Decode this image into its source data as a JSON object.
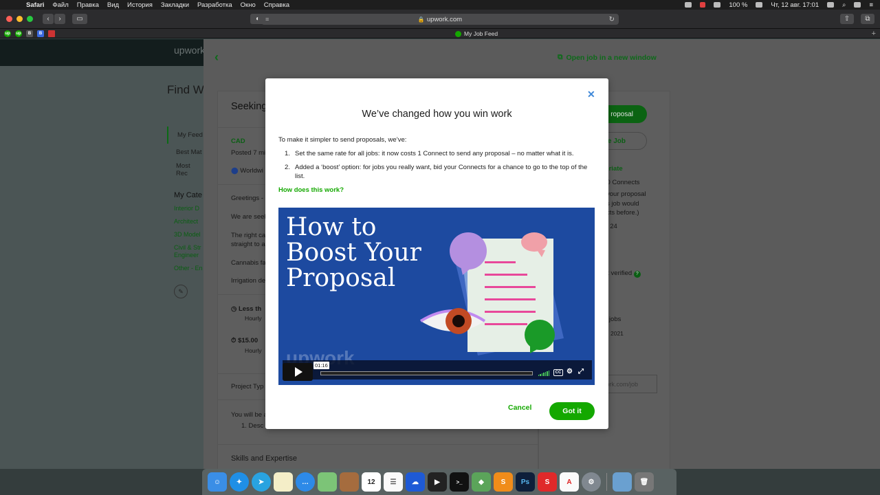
{
  "menubar": {
    "apple": "",
    "app": "Safari",
    "items": [
      "Файл",
      "Правка",
      "Вид",
      "История",
      "Закладки",
      "Разработка",
      "Окно",
      "Справка"
    ],
    "battery": "100 %",
    "datetime": "Чт, 12 авг.  17:01"
  },
  "browser": {
    "url": "upwork.com",
    "tab_title": "My Job Feed"
  },
  "background_page": {
    "logo": "upwork",
    "title": "Find W",
    "nav": [
      "My Feed",
      "Best Mat",
      "Most Rec"
    ],
    "categories_title": "My Cate",
    "categories": [
      "Interior D",
      "Architect",
      "3D Model",
      "Civil & Str",
      "Engineer",
      "Other - En"
    ],
    "open_new_window": "Open job in a new window",
    "job_title": "Seeking",
    "job_category": "CAD",
    "posted": "Posted 7 mi",
    "location": "Worldwi",
    "body_lines": [
      "Greetings -",
      "We are seek",
      "The right ca",
      "straight to a",
      "Cannabis fa",
      "Irrigation de"
    ],
    "duration": "Less th",
    "duration_type": "Hourly",
    "rate": "$15.00",
    "rate_type": "Hourly",
    "project_type": "Project Typ",
    "will_be": "You will be a",
    "desc_item": "1.  Desc",
    "skills": "Skills and Expertise",
    "submit_proposal": "roposal",
    "save_job": "e Job",
    "appropriate": "opriate",
    "connects": "r: 0 Connects",
    "proposal_line1": "your proposal",
    "proposal_line2": "s job would",
    "proposal_line3": "cts before.)",
    "available": ": 24",
    "not_verified": "ot verified",
    "jobs": "n jobs",
    "year": "2021",
    "job_link": "work.com/job"
  },
  "modal": {
    "close": "✕",
    "title": "We’ve changed how you win work",
    "intro": "To make it simpler to send proposals, we’ve:",
    "list": [
      {
        "num": "1.",
        "text": "Set the same rate for all jobs: it now costs 1 Connect to send any proposal – no matter what it is."
      },
      {
        "num": "2.",
        "text": "Added a ‘boost’ option: for jobs you really want, bid your Connects for a chance to go to the top of the list."
      }
    ],
    "how_link": "How does this work?",
    "video": {
      "title": "How to\nBoost Your\nProposal",
      "timecode": "01:16",
      "watermark": "upwork"
    },
    "cancel": "Cancel",
    "got_it": "Got it"
  },
  "colors": {
    "brand_green": "#14a800",
    "video_bg": "#1d4aa0",
    "close_blue": "#3f88d8"
  }
}
